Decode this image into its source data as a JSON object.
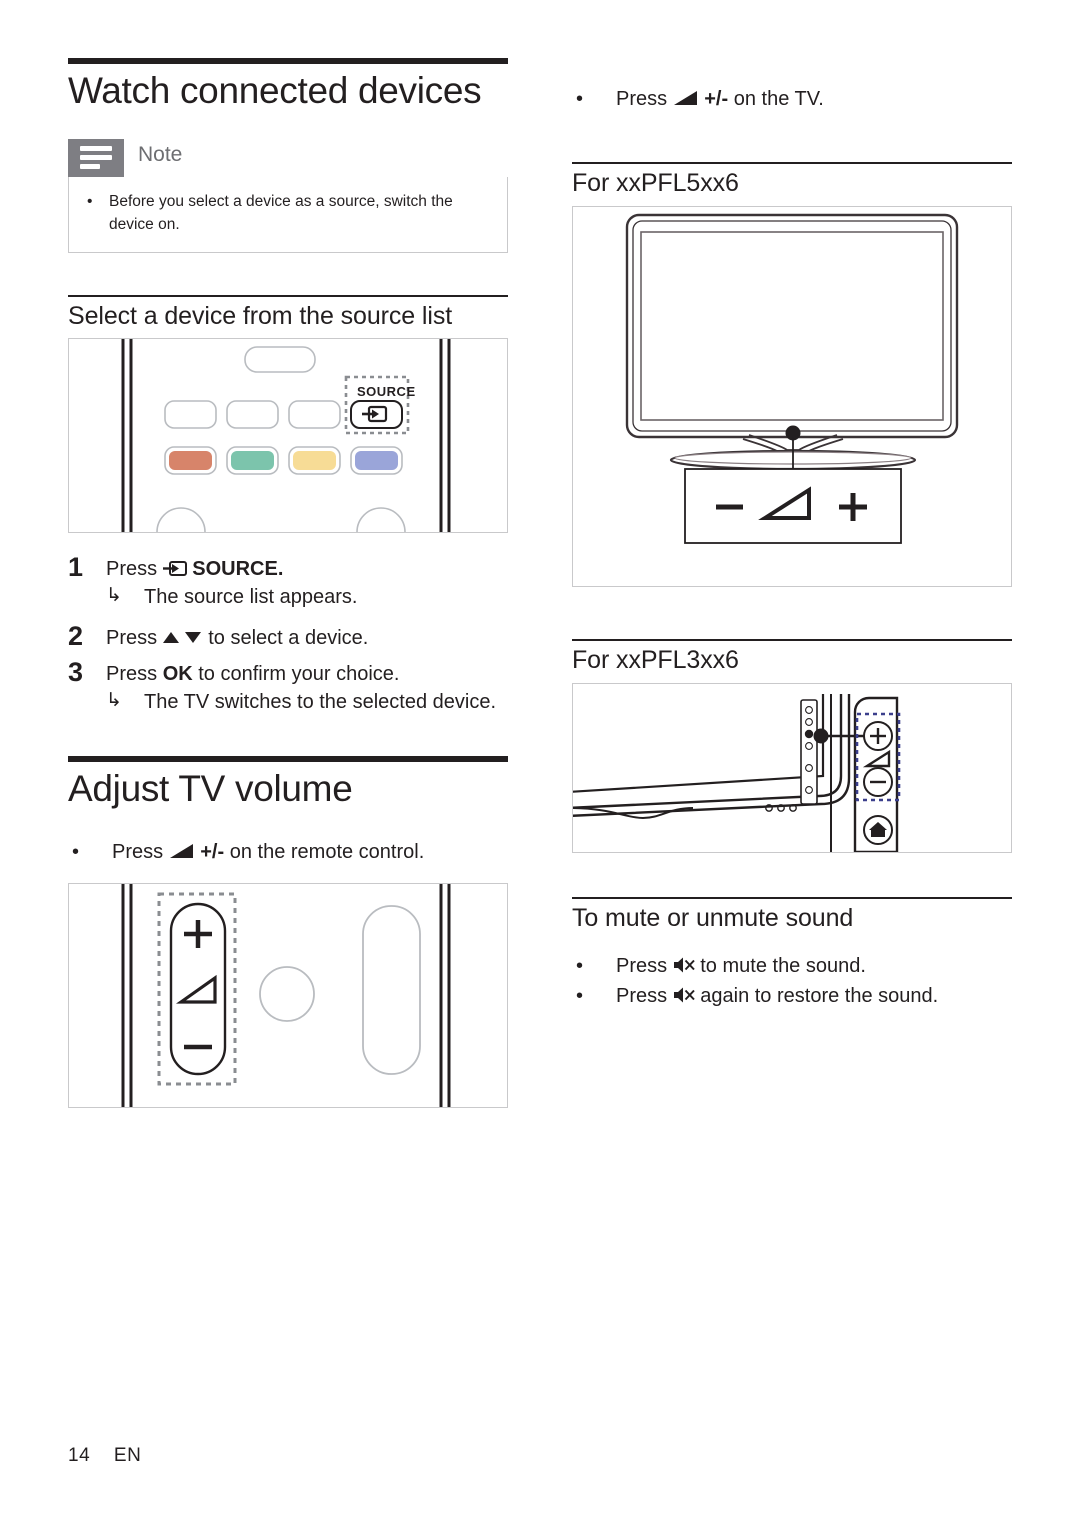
{
  "document": {
    "footer_page_number": "14",
    "footer_language": "EN"
  },
  "colors": {
    "text": "#231f20",
    "note_icon_bg": "#7e7e83",
    "note_title": "#6d6e71",
    "rule": "#231f20",
    "figure_border": "#c9c9cb",
    "remote_red_button": "#d7846a",
    "remote_green_button": "#7cc4ac",
    "remote_yellow_button": "#f7dc96",
    "remote_blue_button": "#9aa5d9"
  },
  "left_column": {
    "chapter_title": "Watch connected devices",
    "note": {
      "icon": "note-lines-icon",
      "title": "Note",
      "items": [
        "Before you select a device as a source, switch the device on."
      ]
    },
    "section_source": {
      "heading": "Select a device from the source list",
      "figure": {
        "name": "remote-control-source-button-figure",
        "source_button_label": "SOURCE",
        "source_button_icon": "source-input-icon",
        "color_buttons": [
          "red",
          "green",
          "yellow",
          "blue"
        ]
      },
      "steps": [
        {
          "number": "1",
          "text_before_icon": "Press ",
          "icon": "source-input-icon",
          "text_after_icon": " SOURCE.",
          "result_arrow": "↳",
          "result": "The source list appears."
        },
        {
          "number": "2",
          "text_before_icon": "Press ",
          "icon": "up-down-arrows-icon",
          "text_after_icon": " to select a device.",
          "result_arrow": "",
          "result": ""
        },
        {
          "number": "3",
          "text_before_icon": "Press ",
          "icon": "ok-label",
          "text_after_icon": " to confirm your choice.",
          "result_arrow": "↳",
          "result": "The TV switches to the selected device."
        }
      ],
      "step1_label_press": "Press",
      "step1_label_source": "SOURCE.",
      "step2_label_press": "Press",
      "step2_label_rest": "to select a device.",
      "step3_label_press": "Press",
      "step3_label_ok": "OK",
      "step3_label_rest": "to confirm your choice.",
      "result1": "The source list appears.",
      "result3": "The TV switches to the selected device.",
      "arrow_glyph": "↳"
    },
    "section_volume": {
      "chapter_title": "Adjust TV volume",
      "bullet": {
        "dot": "•",
        "text_before_icon": "Press",
        "icon": "volume-ramp-icon",
        "text_after_icon": "+/- on the remote control.",
        "plus_minus": "+/-",
        "tail": "on the remote control."
      },
      "figure": {
        "name": "remote-control-volume-rocker-figure",
        "plus": "+",
        "minus": "−",
        "volume_icon": "volume-ramp-icon"
      }
    }
  },
  "right_column": {
    "top_bullet": {
      "dot": "•",
      "text_before_icon": "Press",
      "icon": "volume-ramp-icon",
      "plus_minus": "+/-",
      "tail": "on the TV."
    },
    "section_pfl5": {
      "heading": "For xxPFL5xx6",
      "figure": {
        "name": "tv-front-volume-controls-figure",
        "minus": "−",
        "volume_icon": "volume-ramp-icon",
        "plus": "+"
      }
    },
    "section_pfl3": {
      "heading": "For xxPFL3xx6",
      "figure": {
        "name": "tv-side-volume-controls-figure",
        "plus": "+",
        "minus": "−",
        "volume_icon": "volume-ramp-icon",
        "home_icon": "home-icon"
      }
    },
    "section_mute": {
      "heading": "To mute or unmute sound",
      "items": [
        {
          "dot": "•",
          "text_before_icon": "Press",
          "icon": "mute-icon",
          "tail": "to mute the sound."
        },
        {
          "dot": "•",
          "text_before_icon": "Press",
          "icon": "mute-icon",
          "tail": "again to restore the sound."
        }
      ]
    }
  }
}
